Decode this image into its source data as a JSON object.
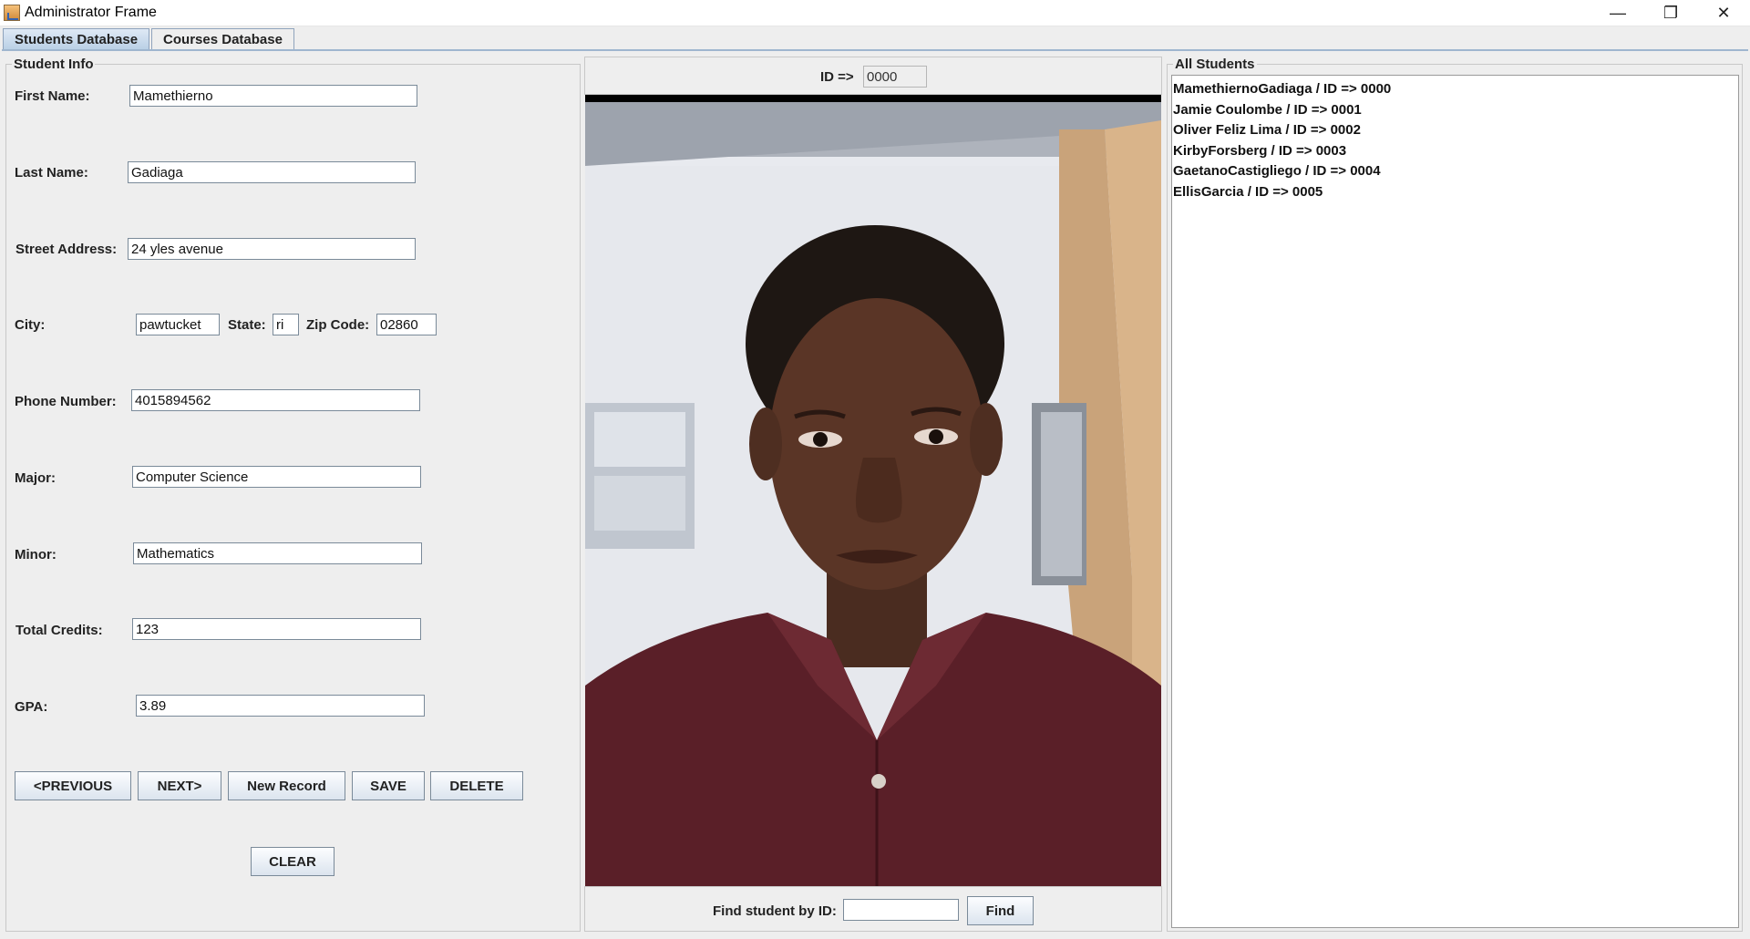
{
  "window": {
    "title": "Administrator Frame",
    "minimize_glyph": "—",
    "maximize_glyph": "❐",
    "close_glyph": "✕"
  },
  "tabs": [
    {
      "label": "Students Database",
      "active": true
    },
    {
      "label": "Courses Database",
      "active": false
    }
  ],
  "student_info": {
    "legend": "Student Info",
    "first_name": {
      "label": "First Name:",
      "value": "Mamethierno"
    },
    "last_name": {
      "label": "Last Name:",
      "value": "Gadiaga"
    },
    "street_address": {
      "label": "Street Address:",
      "value": "24 yles avenue"
    },
    "city": {
      "label": "City:",
      "value": "pawtucket"
    },
    "state": {
      "label": "State:",
      "value": "ri"
    },
    "zip_code": {
      "label": "Zip Code:",
      "value": "02860"
    },
    "phone_number": {
      "label": "Phone Number:",
      "value": "4015894562"
    },
    "major": {
      "label": "Major:",
      "value": "Computer Science"
    },
    "minor": {
      "label": "Minor:",
      "value": "Mathematics"
    },
    "total_credits": {
      "label": "Total Credits:",
      "value": "123"
    },
    "gpa": {
      "label": "GPA:",
      "value": "3.89"
    }
  },
  "buttons": {
    "previous": "<PREVIOUS",
    "next": "NEXT>",
    "new_record": "New Record",
    "save": "SAVE",
    "delete": "DELETE",
    "clear": "CLEAR"
  },
  "id_display": {
    "label": "ID =>",
    "value": "0000"
  },
  "find": {
    "label": "Find student by ID:",
    "value": "",
    "button": "Find"
  },
  "all_students": {
    "legend": "All Students",
    "items": [
      "MamethiernoGadiaga / ID => 0000",
      "Jamie Coulombe / ID => 0001",
      "Oliver Feliz Lima / ID => 0002",
      "KirbyForsberg / ID => 0003",
      "GaetanoCastigliego / ID => 0004",
      "EllisGarcia / ID => 0005"
    ]
  },
  "colors": {
    "tab_active": "#c5d8ec",
    "shirt": "#5a1f28",
    "wall": "#e8eaef",
    "pillar": "#c9a37a"
  }
}
